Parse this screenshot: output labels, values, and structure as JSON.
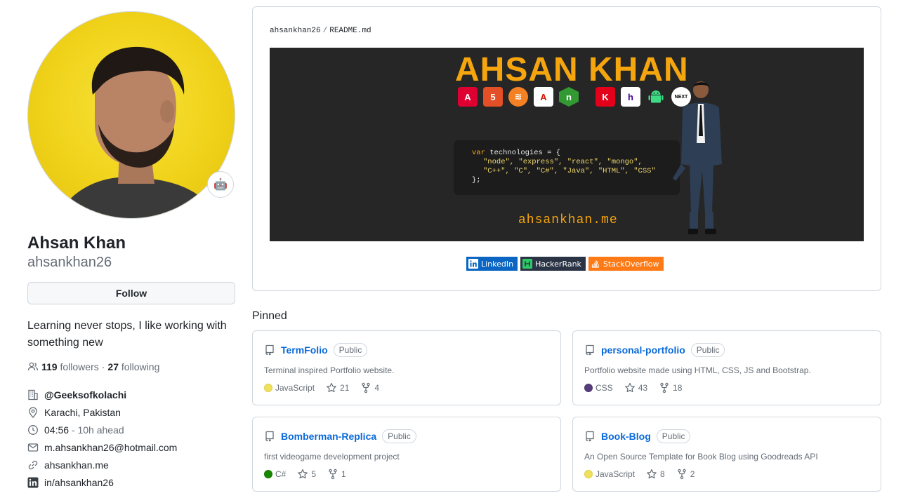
{
  "profile": {
    "name": "Ahsan Khan",
    "login": "ahsankhan26",
    "follow_label": "Follow",
    "bio": "Learning never stops, I like working with something new",
    "followers_count": "119",
    "followers_label": "followers",
    "dot": "·",
    "following_count": "27",
    "following_label": "following",
    "organization": "@Geeksofkolachi",
    "location": "Karachi, Pakistan",
    "local_time": "04:56",
    "time_offset": "- 10h ahead",
    "email": "m.ahsankhan26@hotmail.com",
    "website": "ahsankhan.me",
    "linkedin": "in/ahsankhan26",
    "status_emoji": "🤖"
  },
  "readme": {
    "owner": "ahsankhan26",
    "separator": "/",
    "file": "README.md",
    "banner": {
      "title": "AHSAN KHAN",
      "code_line1_kw": "var",
      "code_line1_rest": " technologies = {",
      "code_line2": "\"node\", \"express\", \"react\", \"mongo\",",
      "code_line3": "\"C++\", \"C\", \"C#\", \"Java\", \"HTML\", \"CSS\"",
      "code_line4": "};",
      "url": "ahsankhan.me"
    },
    "badges": [
      {
        "label": "LinkedIn",
        "color": "#0a66c2"
      },
      {
        "label": "HackerRank",
        "color": "#2b3445"
      },
      {
        "label": "StackOverflow",
        "color": "#fe7a16"
      }
    ]
  },
  "pinned": {
    "title": "Pinned",
    "visibility": "Public",
    "repos": [
      {
        "name": "TermFolio",
        "desc": "Terminal inspired Portfolio website.",
        "lang": "JavaScript",
        "lang_color": "#f1e05a",
        "stars": "21",
        "forks": "4"
      },
      {
        "name": "personal-portfolio",
        "desc": "Portfolio website made using HTML, CSS, JS and Bootstrap.",
        "lang": "CSS",
        "lang_color": "#563d7c",
        "stars": "43",
        "forks": "18"
      },
      {
        "name": "Bomberman-Replica",
        "desc": "first videogame development project",
        "lang": "C#",
        "lang_color": "#178600",
        "stars": "5",
        "forks": "1"
      },
      {
        "name": "Book-Blog",
        "desc": "An Open Source Template for Book Blog using Goodreads API",
        "lang": "JavaScript",
        "lang_color": "#f1e05a",
        "stars": "8",
        "forks": "2"
      }
    ]
  }
}
